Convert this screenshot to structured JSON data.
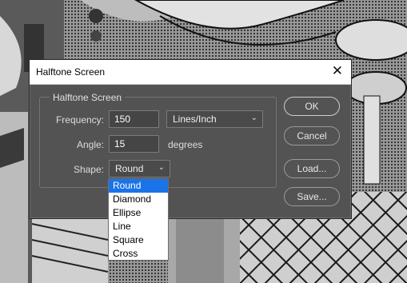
{
  "dialog": {
    "title": "Halftone Screen",
    "group_label": "Halftone Screen",
    "frequency": {
      "label": "Frequency:",
      "value": "150",
      "unit": "Lines/Inch"
    },
    "angle": {
      "label": "Angle:",
      "value": "15",
      "unit": "degrees"
    },
    "shape": {
      "label": "Shape:",
      "value": "Round",
      "options": [
        "Round",
        "Diamond",
        "Ellipse",
        "Line",
        "Square",
        "Cross"
      ]
    },
    "buttons": {
      "ok": "OK",
      "cancel": "Cancel",
      "load": "Load...",
      "save": "Save..."
    }
  },
  "icons": {
    "close": "close-icon",
    "chevron": "chevron-down-icon"
  },
  "colors": {
    "dialog_bg": "#535353",
    "selection": "#1a73e8"
  }
}
